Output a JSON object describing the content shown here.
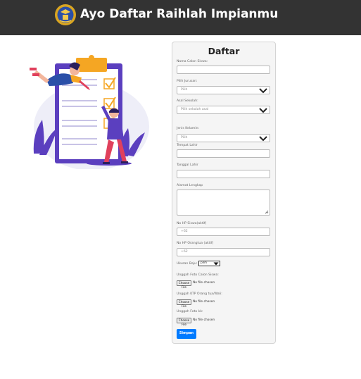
{
  "header": {
    "title": "Ayo Daftar Raihlah Impianmu"
  },
  "form": {
    "title": "Daftar",
    "nama_label": "Nama Calon Siswa:",
    "nama_value": "",
    "jurusan_label": "Pilih Jurusan:",
    "jurusan_selected": "Pilih",
    "sekolah_label": "Asal Sekolah:",
    "sekolah_selected": "Pilih sekolah asal",
    "kelamin_label": "Jenis Kelamin:",
    "kelamin_selected": "Pilih",
    "tempat_label": "Tempat Lahir",
    "tanggal_label": "Tanggal Lahir",
    "alamat_label": "Alamat Lengkap",
    "hp_siswa_label": "No HP Siswa(aktif)",
    "hp_siswa_placeholder": "+62",
    "hp_ortu_label": "No HP Orangtua (aktif)",
    "hp_ortu_placeholder": "+62",
    "baju_label": "Ukuran Baju:",
    "baju_selected": "pilih",
    "foto_label": "Unggah Foto Calon Siswa:",
    "ktp_label": "Unggah KTP Orang tua/Wali:",
    "kk_label": "Unggah Foto kk:",
    "choose_file": "Choose File",
    "no_file": "No file chosen",
    "submit": "Simpan"
  },
  "colors": {
    "header_bg": "#333333",
    "primary": "#007bff",
    "illustration_purple": "#5b3fbf",
    "illustration_orange": "#f5a623"
  }
}
